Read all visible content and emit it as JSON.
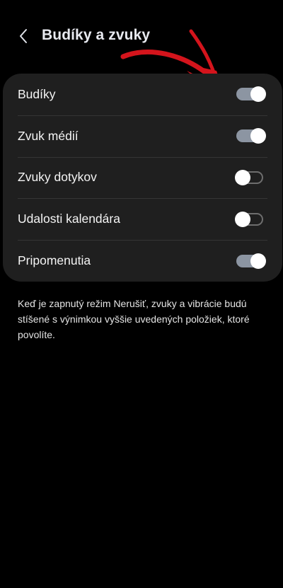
{
  "header": {
    "title": "Budíky a zvuky",
    "back_icon": "chevron-left-icon"
  },
  "annotation": {
    "icon": "red-arrow-icon",
    "color": "#d4141c"
  },
  "settings": {
    "items": [
      {
        "label": "Budíky",
        "enabled": true
      },
      {
        "label": "Zvuk médií",
        "enabled": true
      },
      {
        "label": "Zvuky dotykov",
        "enabled": false
      },
      {
        "label": "Udalosti kalendára",
        "enabled": false
      },
      {
        "label": "Pripomenutia",
        "enabled": true
      }
    ]
  },
  "note": "Keď je zapnutý režim Nerušiť, zvuky a vibrácie budú stíšené s výnimkou vyššie uvedených položiek, ktoré povolíte.",
  "colors": {
    "background": "#000000",
    "card": "#1f1f1f",
    "toggle_on": "#8c95a2",
    "toggle_off_border": "#6e6e6e"
  }
}
